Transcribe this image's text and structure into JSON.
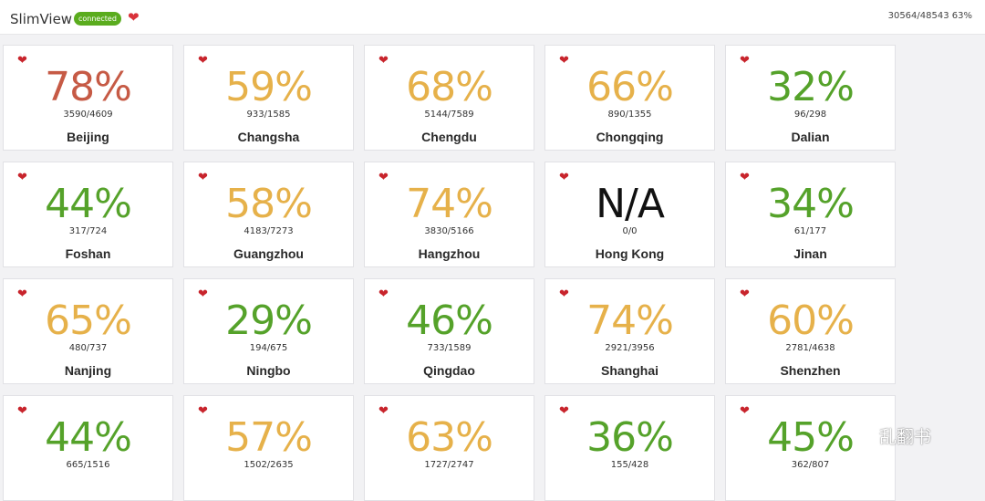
{
  "header": {
    "app_title": "SlimView",
    "status_badge": "connected",
    "heart_icon": "heart-icon",
    "totals": "30564/48543 63%"
  },
  "colors": {
    "red": "#c65a45",
    "orange": "#e6b14a",
    "green": "#55a22a",
    "black": "#111111",
    "heart": "#c8242c",
    "badge": "#5aac1e"
  },
  "cards": [
    {
      "city": "Beijing",
      "percent": "78%",
      "ratio": "3590/4609",
      "color": "red"
    },
    {
      "city": "Changsha",
      "percent": "59%",
      "ratio": "933/1585",
      "color": "orange"
    },
    {
      "city": "Chengdu",
      "percent": "68%",
      "ratio": "5144/7589",
      "color": "orange"
    },
    {
      "city": "Chongqing",
      "percent": "66%",
      "ratio": "890/1355",
      "color": "orange"
    },
    {
      "city": "Dalian",
      "percent": "32%",
      "ratio": "96/298",
      "color": "green"
    },
    {
      "city": "Foshan",
      "percent": "44%",
      "ratio": "317/724",
      "color": "green"
    },
    {
      "city": "Guangzhou",
      "percent": "58%",
      "ratio": "4183/7273",
      "color": "orange"
    },
    {
      "city": "Hangzhou",
      "percent": "74%",
      "ratio": "3830/5166",
      "color": "orange"
    },
    {
      "city": "Hong Kong",
      "percent": "N/A",
      "ratio": "0/0",
      "color": "black"
    },
    {
      "city": "Jinan",
      "percent": "34%",
      "ratio": "61/177",
      "color": "green"
    },
    {
      "city": "Nanjing",
      "percent": "65%",
      "ratio": "480/737",
      "color": "orange"
    },
    {
      "city": "Ningbo",
      "percent": "29%",
      "ratio": "194/675",
      "color": "green"
    },
    {
      "city": "Qingdao",
      "percent": "46%",
      "ratio": "733/1589",
      "color": "green"
    },
    {
      "city": "Shanghai",
      "percent": "74%",
      "ratio": "2921/3956",
      "color": "orange"
    },
    {
      "city": "Shenzhen",
      "percent": "60%",
      "ratio": "2781/4638",
      "color": "orange"
    },
    {
      "city": "",
      "percent": "44%",
      "ratio": "665/1516",
      "color": "green"
    },
    {
      "city": "",
      "percent": "57%",
      "ratio": "1502/2635",
      "color": "orange"
    },
    {
      "city": "",
      "percent": "63%",
      "ratio": "1727/2747",
      "color": "orange"
    },
    {
      "city": "",
      "percent": "36%",
      "ratio": "155/428",
      "color": "green"
    },
    {
      "city": "",
      "percent": "45%",
      "ratio": "362/807",
      "color": "green"
    }
  ],
  "watermark": {
    "icon": "wechat-icon",
    "text": "乱翻书"
  }
}
